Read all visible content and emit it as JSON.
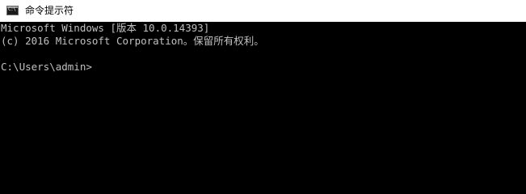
{
  "window": {
    "title": "命令提示符",
    "icon": "cmd-icon",
    "icon_text": "C:\\"
  },
  "console": {
    "lines": [
      "Microsoft Windows [版本 10.0.14393]",
      "(c) 2016 Microsoft Corporation。保留所有权利。",
      "C:\\Users\\admin>"
    ]
  },
  "colors": {
    "console_background": "#000000",
    "console_text": "#c0c0c0",
    "titlebar_background": "#ffffff"
  }
}
